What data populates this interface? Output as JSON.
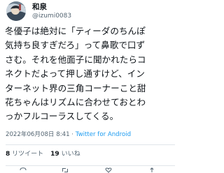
{
  "user": {
    "display_name": "和泉",
    "handle": "@izumi0083"
  },
  "tweet": {
    "text_lines": [
      "冬優子は絶対に「ティーダのちんぽ",
      "気持ち良すぎだろ」って鼻歌で口ず",
      "さむ。それを他面子に聞かれたらコ",
      "ネクトだよって押し通すけど、イン",
      "ターネット界の三角コーナーこと甜",
      "花ちゃんはリズムに合わせておとわ",
      "っかフルコーラスしてくる。"
    ],
    "timestamp": "2022年06月08日 8:41",
    "separator": " · ",
    "source": "Twitter for Android"
  },
  "stats": {
    "retweets_count": "8",
    "retweets_label": "リツイート",
    "likes_count": "19",
    "likes_label": "いいね"
  },
  "icons": {
    "avatar": "avatar-photo",
    "reply": "reply-icon",
    "retweet": "retweet-icon",
    "like": "heart-icon",
    "share": "share-icon"
  }
}
